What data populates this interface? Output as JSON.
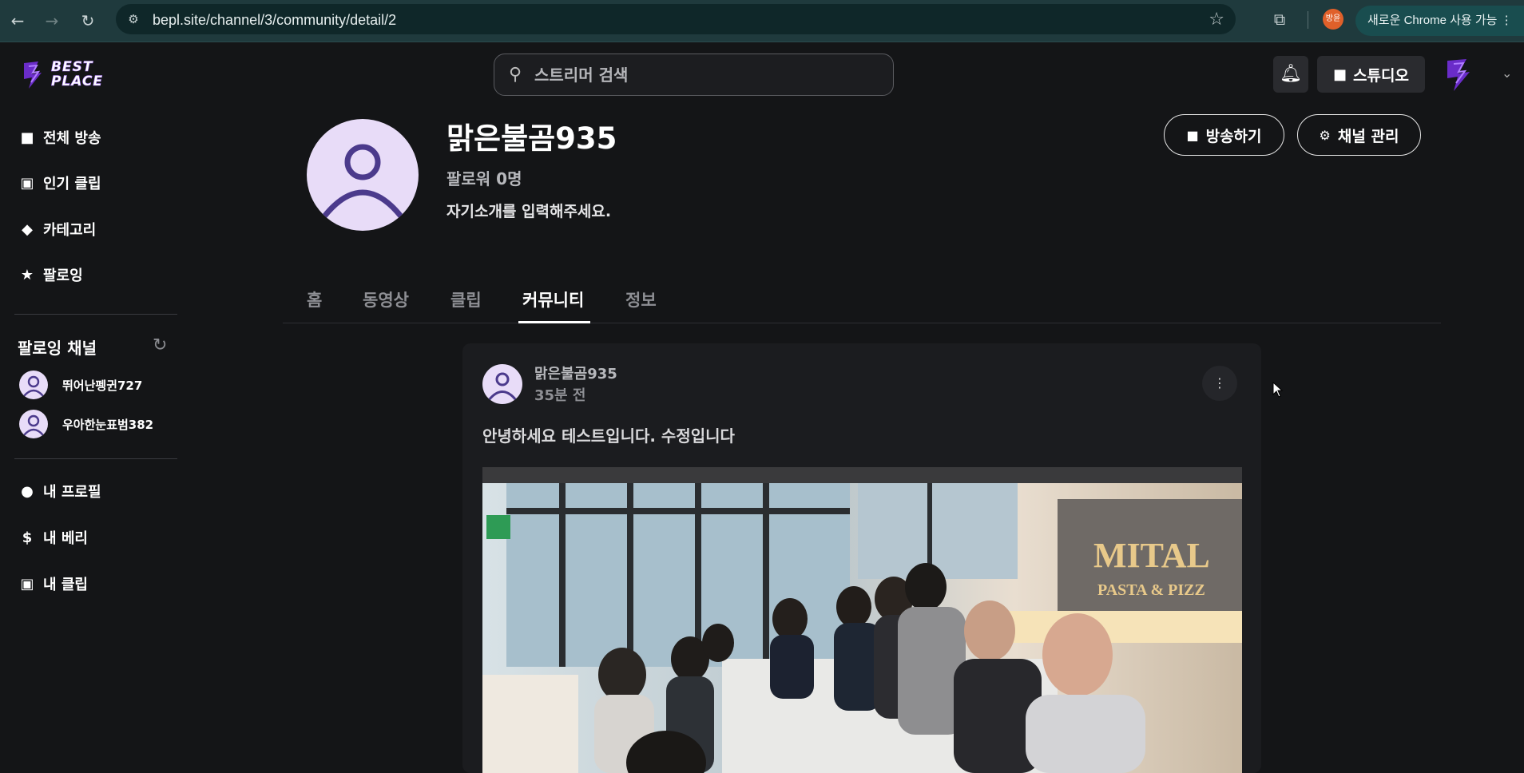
{
  "browser": {
    "url": "bepl.site/channel/3/community/detail/2",
    "profile_chip": "방윤",
    "update_label": "새로운 Chrome 사용 가능"
  },
  "sidebar": {
    "logo_text": "BEST PLACE",
    "nav": [
      {
        "label": "전체 방송",
        "icon": "video-camera-icon"
      },
      {
        "label": "인기 클립",
        "icon": "clip-icon"
      },
      {
        "label": "카테고리",
        "icon": "tags-icon"
      },
      {
        "label": "팔로잉",
        "icon": "star-icon"
      }
    ],
    "following_title": "팔로잉 채널",
    "following_channels": [
      {
        "name": "뛰어난펭귄727"
      },
      {
        "name": "우아한눈표범382"
      }
    ],
    "my_nav": [
      {
        "label": "내 프로필",
        "icon": "user-icon"
      },
      {
        "label": "내 베리",
        "icon": "dollar-icon"
      },
      {
        "label": "내 클립",
        "icon": "clip-icon"
      }
    ]
  },
  "header": {
    "search_placeholder": "스트리머 검색",
    "studio_label": "스튜디오"
  },
  "channel": {
    "name": "맑은불곰935",
    "followers": "팔로워 0명",
    "intro": "자기소개를 입력해주세요.",
    "broadcast_label": "방송하기",
    "manage_label": "채널 관리"
  },
  "tabs": [
    {
      "label": "홈",
      "active": false
    },
    {
      "label": "동영상",
      "active": false
    },
    {
      "label": "클립",
      "active": false
    },
    {
      "label": "커뮤니티",
      "active": true
    },
    {
      "label": "정보",
      "active": false
    }
  ],
  "post": {
    "author": "맑은불곰935",
    "time": "35분 전",
    "text": "안녕하세요 테스트입니다. 수정입니다",
    "image_sign_line1": "MITAL",
    "image_sign_line2": "PASTA & PIZZ"
  },
  "colors": {
    "background": "#141517",
    "avatar_bg": "#e8dcf8",
    "avatar_fg": "#4b3a8c",
    "brand_purple": "#7a3ad8"
  }
}
